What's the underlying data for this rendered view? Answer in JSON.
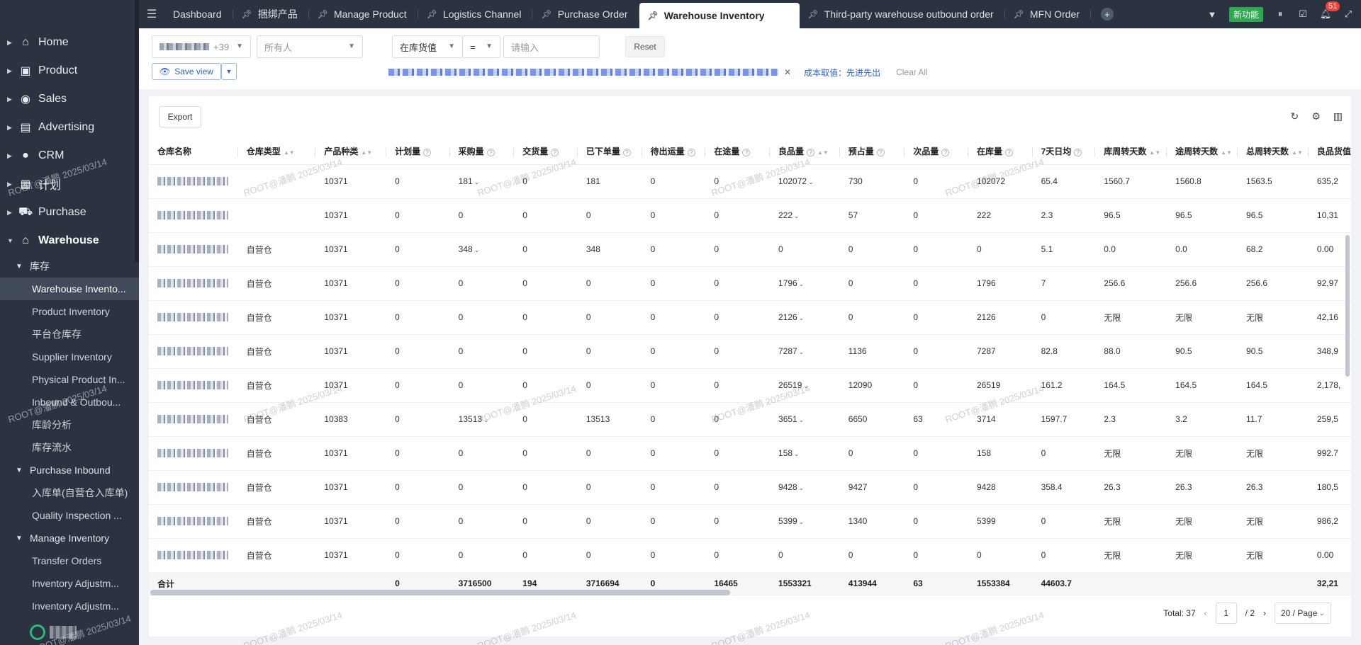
{
  "sidebar": {
    "items": [
      {
        "label": "Home",
        "icon": "home-icon",
        "glyph": "⌂"
      },
      {
        "label": "Product",
        "icon": "box-icon",
        "glyph": "▣"
      },
      {
        "label": "Sales",
        "icon": "sales-icon",
        "glyph": "◉"
      },
      {
        "label": "Advertising",
        "icon": "ad-icon",
        "glyph": "▤"
      },
      {
        "label": "CRM",
        "icon": "crm-icon",
        "glyph": "●"
      },
      {
        "label": "计划",
        "icon": "plan-icon",
        "glyph": "▦"
      },
      {
        "label": "Purchase",
        "icon": "cart-icon",
        "glyph": "⛟"
      },
      {
        "label": "Warehouse",
        "icon": "warehouse-icon",
        "glyph": "⌂"
      }
    ],
    "group_inventory": {
      "label": "库存",
      "leaves": [
        "Warehouse Invento...",
        "Product Inventory",
        "平台仓库存",
        "Supplier Inventory",
        "Physical Product In...",
        "Inbound & Outbou...",
        "库龄分析",
        "库存流水"
      ]
    },
    "group_purchase_inbound": {
      "label": "Purchase Inbound",
      "leaves": [
        "入库单(自营仓入库单)",
        "Quality Inspection ..."
      ]
    },
    "group_manage_inventory": {
      "label": "Manage Inventory",
      "leaves": [
        "Transfer Orders",
        "Inventory Adjustm...",
        "Inventory Adjustm..."
      ]
    }
  },
  "tabs": [
    {
      "label": "Dashboard",
      "pinned": false,
      "active": false
    },
    {
      "label": "捆绑产品",
      "pinned": true,
      "active": false
    },
    {
      "label": "Manage Product",
      "pinned": true,
      "active": false
    },
    {
      "label": "Logistics Channel",
      "pinned": true,
      "active": false
    },
    {
      "label": "Purchase Order",
      "pinned": true,
      "active": false
    },
    {
      "label": "Warehouse Inventory",
      "pinned": true,
      "active": true
    },
    {
      "label": "Third-party warehouse outbound order",
      "pinned": true,
      "active": false
    },
    {
      "label": "MFN Order",
      "pinned": true,
      "active": false
    }
  ],
  "topbar": {
    "new_feature": "新功能",
    "notification_count": "51"
  },
  "filters": {
    "warehouse_count": "+39",
    "owner_placeholder": "所有人",
    "metric": "在库货值",
    "operator": "=",
    "value_placeholder": "请输入",
    "reset": "Reset",
    "save_view": "Save view",
    "cost_label": "成本取值：先进先出",
    "clear_all": "Clear All"
  },
  "toolbar": {
    "export": "Export"
  },
  "table": {
    "columns": [
      "仓库名称",
      "仓库类型",
      "产品种类",
      "计划量",
      "采购量",
      "交货量",
      "已下单量",
      "待出运量",
      "在途量",
      "良品量",
      "预占量",
      "次品量",
      "在库量",
      "7天日均",
      "库周转天数",
      "途周转天数",
      "总周转天数",
      "良品货值"
    ],
    "rows": [
      {
        "type": "",
        "kinds": "10371",
        "plan": "0",
        "purchase": "181",
        "purchase_dd": true,
        "deliver": "0",
        "ordered": "181",
        "pending": "0",
        "transit": "0",
        "good": "102072",
        "good_dd": true,
        "reserved": "730",
        "defect": "0",
        "stock": "102072",
        "avg7": "65.4",
        "stockTurn": "1560.7",
        "transitTurn": "1560.8",
        "totalTurn": "1563.5",
        "goodValue": "635,2"
      },
      {
        "type": "",
        "kinds": "10371",
        "plan": "0",
        "purchase": "0",
        "purchase_dd": false,
        "deliver": "0",
        "ordered": "0",
        "pending": "0",
        "transit": "0",
        "good": "222",
        "good_dd": true,
        "reserved": "57",
        "defect": "0",
        "stock": "222",
        "avg7": "2.3",
        "stockTurn": "96.5",
        "transitTurn": "96.5",
        "totalTurn": "96.5",
        "goodValue": "10,31"
      },
      {
        "type": "自营仓",
        "kinds": "10371",
        "plan": "0",
        "purchase": "348",
        "purchase_dd": true,
        "deliver": "0",
        "ordered": "348",
        "pending": "0",
        "transit": "0",
        "good": "0",
        "good_dd": false,
        "reserved": "0",
        "defect": "0",
        "stock": "0",
        "avg7": "5.1",
        "stockTurn": "0.0",
        "transitTurn": "0.0",
        "totalTurn": "68.2",
        "goodValue": "0.00"
      },
      {
        "type": "自营仓",
        "kinds": "10371",
        "plan": "0",
        "purchase": "0",
        "purchase_dd": false,
        "deliver": "0",
        "ordered": "0",
        "pending": "0",
        "transit": "0",
        "good": "1796",
        "good_dd": true,
        "reserved": "0",
        "defect": "0",
        "stock": "1796",
        "avg7": "7",
        "stockTurn": "256.6",
        "transitTurn": "256.6",
        "totalTurn": "256.6",
        "goodValue": "92,97"
      },
      {
        "type": "自营仓",
        "kinds": "10371",
        "plan": "0",
        "purchase": "0",
        "purchase_dd": false,
        "deliver": "0",
        "ordered": "0",
        "pending": "0",
        "transit": "0",
        "good": "2126",
        "good_dd": true,
        "reserved": "0",
        "defect": "0",
        "stock": "2126",
        "avg7": "0",
        "stockTurn": "无限",
        "transitTurn": "无限",
        "totalTurn": "无限",
        "goodValue": "42,16"
      },
      {
        "type": "自营仓",
        "kinds": "10371",
        "plan": "0",
        "purchase": "0",
        "purchase_dd": false,
        "deliver": "0",
        "ordered": "0",
        "pending": "0",
        "transit": "0",
        "good": "7287",
        "good_dd": true,
        "reserved": "1136",
        "defect": "0",
        "stock": "7287",
        "avg7": "82.8",
        "stockTurn": "88.0",
        "transitTurn": "90.5",
        "totalTurn": "90.5",
        "goodValue": "348,9"
      },
      {
        "type": "自营仓",
        "kinds": "10371",
        "plan": "0",
        "purchase": "0",
        "purchase_dd": false,
        "deliver": "0",
        "ordered": "0",
        "pending": "0",
        "transit": "0",
        "good": "26519",
        "good_dd": true,
        "reserved": "12090",
        "defect": "0",
        "stock": "26519",
        "avg7": "161.2",
        "stockTurn": "164.5",
        "transitTurn": "164.5",
        "totalTurn": "164.5",
        "goodValue": "2,178,"
      },
      {
        "type": "自营仓",
        "kinds": "10383",
        "plan": "0",
        "purchase": "13513",
        "purchase_dd": true,
        "deliver": "0",
        "ordered": "13513",
        "pending": "0",
        "transit": "0",
        "good": "3651",
        "good_dd": true,
        "reserved": "6650",
        "defect": "63",
        "stock": "3714",
        "avg7": "1597.7",
        "stockTurn": "2.3",
        "transitTurn": "3.2",
        "totalTurn": "11.7",
        "goodValue": "259,5"
      },
      {
        "type": "自营仓",
        "kinds": "10371",
        "plan": "0",
        "purchase": "0",
        "purchase_dd": false,
        "deliver": "0",
        "ordered": "0",
        "pending": "0",
        "transit": "0",
        "good": "158",
        "good_dd": true,
        "reserved": "0",
        "defect": "0",
        "stock": "158",
        "avg7": "0",
        "stockTurn": "无限",
        "transitTurn": "无限",
        "totalTurn": "无限",
        "goodValue": "992.7"
      },
      {
        "type": "自营仓",
        "kinds": "10371",
        "plan": "0",
        "purchase": "0",
        "purchase_dd": false,
        "deliver": "0",
        "ordered": "0",
        "pending": "0",
        "transit": "0",
        "good": "9428",
        "good_dd": true,
        "reserved": "9427",
        "defect": "0",
        "stock": "9428",
        "avg7": "358.4",
        "stockTurn": "26.3",
        "transitTurn": "26.3",
        "totalTurn": "26.3",
        "goodValue": "180,5"
      },
      {
        "type": "自营仓",
        "kinds": "10371",
        "plan": "0",
        "purchase": "0",
        "purchase_dd": false,
        "deliver": "0",
        "ordered": "0",
        "pending": "0",
        "transit": "0",
        "good": "5399",
        "good_dd": true,
        "reserved": "1340",
        "defect": "0",
        "stock": "5399",
        "avg7": "0",
        "stockTurn": "无限",
        "transitTurn": "无限",
        "totalTurn": "无限",
        "goodValue": "986,2"
      },
      {
        "type": "自营仓",
        "kinds": "10371",
        "plan": "0",
        "purchase": "0",
        "purchase_dd": false,
        "deliver": "0",
        "ordered": "0",
        "pending": "0",
        "transit": "0",
        "good": "0",
        "good_dd": false,
        "reserved": "0",
        "defect": "0",
        "stock": "0",
        "avg7": "0",
        "stockTurn": "无限",
        "transitTurn": "无限",
        "totalTurn": "无限",
        "goodValue": "0.00"
      }
    ],
    "total": {
      "label": "合计",
      "plan": "0",
      "purchase": "3716500",
      "deliver": "194",
      "ordered": "3716694",
      "pending": "0",
      "transit": "16465",
      "good": "1553321",
      "reserved": "413944",
      "defect": "63",
      "stock": "1553384",
      "avg7": "44603.7",
      "goodValue": "32,21"
    }
  },
  "pagination": {
    "total": "Total: 37",
    "page": "1",
    "pages": "/ 2",
    "page_size": "20 / Page"
  },
  "watermark": "ROOT@潘鹏 2025/03/14",
  "colors": {
    "sidebar_bg": "#2b3240",
    "accent": "#2b63d9",
    "new_feature": "#2fa94f",
    "badge": "#f04438"
  }
}
